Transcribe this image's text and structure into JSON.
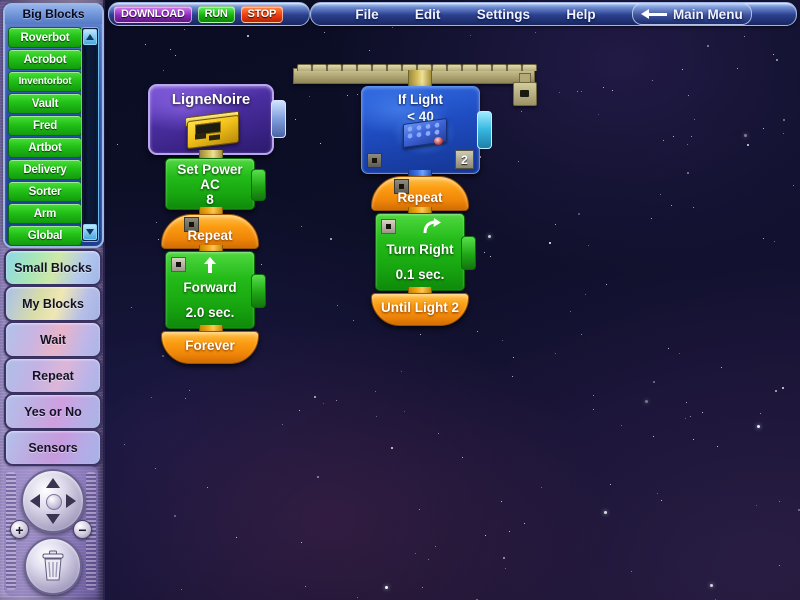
{
  "toolbar": {
    "download_label": "DOWNLOAD",
    "run_label": "RUN",
    "stop_label": "STOP",
    "download_color": "#8a2bbd",
    "run_color": "#16b40e",
    "stop_color": "#ef3b10"
  },
  "menu": {
    "items": [
      {
        "label": "File"
      },
      {
        "label": "Edit"
      },
      {
        "label": "Settings"
      },
      {
        "label": "Help"
      }
    ],
    "main_menu_label": "Main Menu",
    "main_menu_icon": "arrow-left-icon"
  },
  "sidebar": {
    "big_blocks": {
      "title": "Big Blocks",
      "items": [
        {
          "label": "Roverbot"
        },
        {
          "label": "Acrobot"
        },
        {
          "label": "Inventorbot"
        },
        {
          "label": "Vault"
        },
        {
          "label": "Fred"
        },
        {
          "label": "Artbot"
        },
        {
          "label": "Delivery"
        },
        {
          "label": "Sorter"
        },
        {
          "label": "Arm"
        },
        {
          "label": "Global"
        }
      ],
      "scrollbar": {
        "up_icon": "triangle-up-icon",
        "down_icon": "triangle-down-icon"
      }
    },
    "categories": [
      {
        "label": "Small Blocks"
      },
      {
        "label": "My Blocks"
      },
      {
        "label": "Wait"
      },
      {
        "label": "Repeat"
      },
      {
        "label": "Yes or No"
      },
      {
        "label": "Sensors"
      }
    ],
    "nav": {
      "dpad_icon": "dpad-icon",
      "zoom_in_label": "+",
      "zoom_out_label": "−",
      "trash_icon": "trash-can-icon"
    }
  },
  "program": {
    "title_block": {
      "name": "LigneNoire",
      "icon": "rcx-brick-icon"
    },
    "left_stack": [
      {
        "type": "action",
        "name": "set-power-block",
        "lines": [
          "Set Power",
          "AC",
          "8"
        ],
        "icon": null
      },
      {
        "type": "loop-start",
        "name": "repeat-block",
        "label": "Repeat",
        "icon": "small-square-icon"
      },
      {
        "type": "action",
        "name": "forward-block",
        "lines": [
          "Forward",
          "2.0 sec."
        ],
        "icon": "arrow-up-icon"
      },
      {
        "type": "loop-end",
        "name": "forever-block",
        "label": "Forever"
      }
    ],
    "right_stack": [
      {
        "type": "sensor",
        "name": "if-light-block",
        "lines": [
          "If Light",
          "< 40"
        ],
        "icon": "light-sensor-brick-icon",
        "port": "2"
      },
      {
        "type": "loop-start",
        "name": "repeat-block",
        "label": "Repeat",
        "icon": "small-square-icon"
      },
      {
        "type": "action",
        "name": "turn-right-block",
        "lines": [
          "Turn Right",
          "0.1 sec."
        ],
        "icon": "arrow-turn-right-icon"
      },
      {
        "type": "loop-end",
        "name": "until-light-block",
        "label": "Until Light 2"
      }
    ]
  },
  "colors": {
    "action_green": "#23bb19",
    "loop_orange": "#fb9c12",
    "sensor_blue": "#1f4cc0",
    "title_purple": "#4a2ea0"
  }
}
